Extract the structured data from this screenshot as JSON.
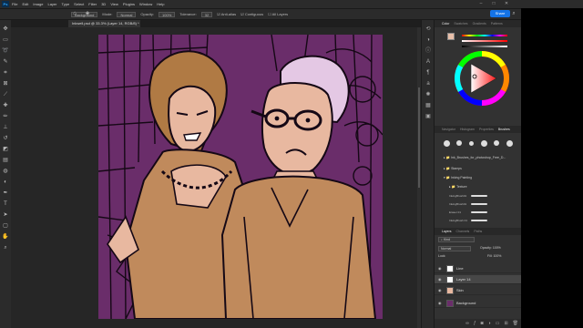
{
  "app": {
    "logo": "Ps",
    "menu": [
      "File",
      "Edit",
      "Image",
      "Layer",
      "Type",
      "Select",
      "Filter",
      "3D",
      "View",
      "Plugins",
      "Window",
      "Help"
    ],
    "window_controls": [
      "minimize-icon",
      "maximize-icon",
      "close-icon"
    ]
  },
  "options": {
    "brush_mode": "Background",
    "mode_label": "Mode:",
    "mode_value": "Normal",
    "opacity_label": "Opacity:",
    "opacity_value": "100%",
    "tolerance_label": "Tolerance:",
    "tolerance_value": "32",
    "anti_alias": "Anti-alias",
    "contiguous": "Contiguous",
    "all_layers": "All Layers",
    "share": "Share"
  },
  "document": {
    "tab_title": "Inkwell.psd @ 33.3% (Layer 14, RGB/8) *"
  },
  "panels": {
    "color_tabs": [
      "Color",
      "Swatches",
      "Gradients",
      "Patterns"
    ],
    "brush_tabs": [
      "Navigator",
      "Histogram",
      "Properties",
      "Brushes"
    ],
    "brush_folders": [
      {
        "name": "Ink_Brushes_for_photoshop_Free_D..."
      },
      {
        "name": "Stamps"
      },
      {
        "name": "Inking Painting"
      },
      {
        "name": "Texture"
      }
    ],
    "brushes": [
      {
        "label": "InkingBrush01"
      },
      {
        "label": "InkingBrush01"
      },
      {
        "label": "Eraser 01"
      },
      {
        "label": "InkingBrush 01"
      }
    ],
    "layer_tabs": [
      "Layers",
      "Channels",
      "Paths"
    ],
    "layer_kind": "Kind",
    "layer_mode": "Normal",
    "layer_opacity_label": "Opacity:",
    "layer_opacity_value": "100%",
    "layer_fill_label": "Fill:",
    "layer_fill_value": "100%",
    "lock_label": "Lock:",
    "layers": [
      {
        "name": "Line",
        "type": "normal"
      },
      {
        "name": "Layer 14",
        "type": "selected"
      },
      {
        "name": "Skin",
        "type": "normal"
      },
      {
        "name": "Background",
        "type": "normal"
      }
    ]
  },
  "colors": {
    "accent": "#1473e6",
    "foreground": "#e8bfa9",
    "background": "#ffffff",
    "purple_bg": "#6a2d6a",
    "skin": "#e8b8a0",
    "jacket": "#c08a5c",
    "hat": "#e4c8e4",
    "hair": "#b07a44"
  },
  "icons": {
    "tools": [
      "move-icon",
      "marquee-icon",
      "lasso-icon",
      "quick-select-icon",
      "crop-icon",
      "frame-icon",
      "eyedropper-icon",
      "healing-icon",
      "brush-icon",
      "stamp-icon",
      "history-brush-icon",
      "eraser-icon",
      "gradient-icon",
      "blur-icon",
      "dodge-icon",
      "pen-icon",
      "type-icon",
      "path-select-icon",
      "shape-icon",
      "hand-icon",
      "zoom-icon"
    ],
    "strip": [
      "history-icon",
      "adjust-icon",
      "info-icon",
      "char-icon",
      "para-icon",
      "glyph-icon",
      "brush-settings-icon",
      "swatch-icon",
      "library-icon"
    ]
  }
}
